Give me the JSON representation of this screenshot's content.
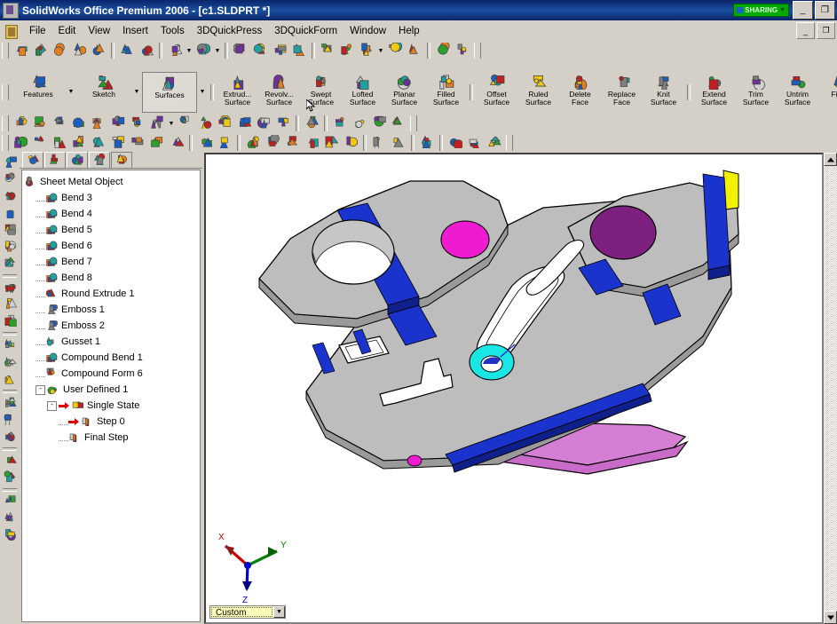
{
  "window": {
    "title": "SolidWorks Office Premium 2006 - [c1.SLDPRT *]",
    "app_icon": "solidworks-icon",
    "sharing_badge": "SHARING",
    "minimize_label": "_",
    "restore_label": "❐",
    "doc_minimize_label": "_",
    "doc_restore_label": "❐"
  },
  "menu": {
    "items": [
      {
        "label": "File"
      },
      {
        "label": "Edit"
      },
      {
        "label": "View"
      },
      {
        "label": "Insert"
      },
      {
        "label": "Tools"
      },
      {
        "label": "3DQuickPress"
      },
      {
        "label": "3DQuickForm"
      },
      {
        "label": "Window"
      },
      {
        "label": "Help"
      }
    ]
  },
  "standard_toolbar": {
    "buttons": [
      {
        "name": "new-document",
        "icon": "new-file-icon"
      },
      {
        "name": "open-document",
        "icon": "open-folder-icon"
      },
      {
        "name": "save-document",
        "icon": "save-disk-icon"
      },
      {
        "name": "make-drawing",
        "icon": "drawing-sheet-icon"
      },
      {
        "name": "make-assembly",
        "icon": "assembly-icon"
      },
      {
        "name": "print",
        "icon": "printer-icon"
      },
      {
        "name": "print-preview",
        "icon": "print-preview-icon"
      },
      {
        "name": "undo",
        "icon": "undo-arrow-icon"
      },
      {
        "name": "redo",
        "icon": "redo-arrow-icon"
      },
      {
        "name": "select",
        "icon": "arrow-cursor-icon"
      },
      {
        "name": "measure",
        "icon": "measure-icon"
      },
      {
        "name": "edit-color",
        "icon": "color-palette-icon"
      },
      {
        "name": "check-status",
        "icon": "traffic-light-icon"
      },
      {
        "name": "display-grid",
        "icon": "grid-icon"
      },
      {
        "name": "material-editor",
        "icon": "brick-material-icon"
      },
      {
        "name": "dimension-display",
        "icon": "dimension-icon"
      },
      {
        "name": "rebuild",
        "icon": "rebuild-traffic-icon"
      },
      {
        "name": "options",
        "icon": "options-gear-icon"
      },
      {
        "name": "help-topic",
        "icon": "help-question-icon"
      },
      {
        "name": "toolbox",
        "icon": "toolbox-icon"
      }
    ]
  },
  "feature_toolbar": {
    "groups": [
      {
        "name": "features",
        "label": "Features",
        "icon": "features-icon",
        "has_dropdown": true,
        "selected": false
      },
      {
        "name": "sketch",
        "label": "Sketch",
        "icon": "sketch-pencil-icon",
        "has_dropdown": true,
        "selected": false
      },
      {
        "name": "surfaces",
        "label": "Surfaces",
        "icon": "surfaces-icon",
        "has_dropdown": true,
        "selected": true
      }
    ],
    "buttons": [
      {
        "name": "extruded-surface",
        "line1": "Extrud...",
        "line2": "Surface",
        "icon": "extruded-surface-icon"
      },
      {
        "name": "revolved-surface",
        "line1": "Revolv...",
        "line2": "Surface",
        "icon": "revolved-surface-icon"
      },
      {
        "name": "swept-surface",
        "line1": "Swept",
        "line2": "Surface",
        "icon": "swept-surface-icon"
      },
      {
        "name": "lofted-surface",
        "line1": "Lofted",
        "line2": "Surface",
        "icon": "lofted-surface-icon"
      },
      {
        "name": "planar-surface",
        "line1": "Planar",
        "line2": "Surface",
        "icon": "planar-surface-icon"
      },
      {
        "name": "filled-surface",
        "line1": "Filled",
        "line2": "Surface",
        "icon": "filled-surface-icon"
      },
      {
        "name": "offset-surface",
        "line1": "Offset",
        "line2": "Surface",
        "icon": "offset-surface-icon"
      },
      {
        "name": "ruled-surface",
        "line1": "Ruled",
        "line2": "Surface",
        "icon": "ruled-surface-icon"
      },
      {
        "name": "delete-face",
        "line1": "Delete",
        "line2": "Face",
        "icon": "delete-face-icon"
      },
      {
        "name": "replace-face",
        "line1": "Replace",
        "line2": "Face",
        "icon": "replace-face-icon"
      },
      {
        "name": "knit-surface",
        "line1": "Knit",
        "line2": "Surface",
        "icon": "knit-surface-icon"
      },
      {
        "name": "extend-surface",
        "line1": "Extend",
        "line2": "Surface",
        "icon": "extend-surface-icon"
      },
      {
        "name": "trim-surface",
        "line1": "Trim",
        "line2": "Surface",
        "icon": "trim-surface-icon"
      },
      {
        "name": "untrim-surface",
        "line1": "Untrim",
        "line2": "Surface",
        "icon": "untrim-surface-icon"
      },
      {
        "name": "fillet",
        "line1": "Fillet",
        "line2": "",
        "icon": "fillet-icon"
      }
    ]
  },
  "view_toolbar": {
    "buttons": [
      {
        "name": "previous-view",
        "icon": "previous-view-icon"
      },
      {
        "name": "zoom-to-fit",
        "icon": "zoom-fit-icon"
      },
      {
        "name": "zoom-to-area",
        "icon": "zoom-area-icon"
      },
      {
        "name": "zoom-in-out",
        "icon": "zoom-in-out-icon"
      },
      {
        "name": "zoom-to-selection",
        "icon": "zoom-selection-icon"
      },
      {
        "name": "rotate-view",
        "icon": "rotate-view-icon"
      },
      {
        "name": "pan",
        "icon": "pan-icon"
      },
      {
        "name": "standard-views",
        "icon": "standard-views-icon",
        "has_dropdown": true
      },
      {
        "name": "wireframe",
        "icon": "wireframe-icon"
      },
      {
        "name": "hidden-lines-visible",
        "icon": "hidden-lines-visible-icon"
      },
      {
        "name": "hidden-lines-removed",
        "icon": "hidden-lines-removed-icon"
      },
      {
        "name": "shaded-with-edges",
        "icon": "shaded-edges-icon"
      },
      {
        "name": "shaded",
        "icon": "shaded-icon"
      },
      {
        "name": "shadows-in-shaded-mode",
        "icon": "shadows-icon"
      },
      {
        "name": "section-view",
        "icon": "section-view-icon"
      },
      {
        "name": "realview-graphics",
        "icon": "realview-icon"
      },
      {
        "name": "curvature-display",
        "icon": "curvature-icon"
      },
      {
        "name": "draft-analysis",
        "icon": "draft-analysis-icon"
      },
      {
        "name": "zebra-stripes",
        "icon": "zebra-stripes-icon"
      }
    ]
  },
  "sheetmetal_toolbar": {
    "buttons": [
      {
        "name": "base-flange",
        "icon": "base-flange-icon"
      },
      {
        "name": "flatten",
        "icon": "flatten-icon"
      },
      {
        "name": "insert-bends",
        "icon": "insert-bends-icon"
      },
      {
        "name": "edge-flange",
        "icon": "edge-flange-icon"
      },
      {
        "name": "miter-flange",
        "icon": "miter-flange-icon"
      },
      {
        "name": "hem",
        "icon": "hem-icon"
      },
      {
        "name": "jog",
        "icon": "jog-icon"
      },
      {
        "name": "sketched-bend",
        "icon": "sketched-bend-icon"
      },
      {
        "name": "closed-corner",
        "icon": "closed-corner-icon"
      },
      {
        "name": "quickpress-tool-a",
        "icon": "quickpress-icon-a"
      },
      {
        "name": "quickpress-tool-b",
        "icon": "quickpress-icon-b"
      },
      {
        "name": "form-tool-1",
        "icon": "form-tool-1-icon"
      },
      {
        "name": "form-tool-2",
        "icon": "form-tool-2-icon"
      },
      {
        "name": "form-tool-3",
        "icon": "form-tool-3-icon"
      },
      {
        "name": "form-tool-4",
        "icon": "form-tool-4-icon"
      },
      {
        "name": "form-tool-5",
        "icon": "form-tool-5-icon"
      },
      {
        "name": "form-tool-6",
        "icon": "form-tool-6-icon"
      },
      {
        "name": "form-tool-7",
        "icon": "form-tool-7-icon"
      },
      {
        "name": "form-tool-8",
        "icon": "form-tool-8-icon"
      },
      {
        "name": "form-tool-9",
        "icon": "form-tool-9-icon"
      },
      {
        "name": "mold-tool-1",
        "icon": "mold-tool-1-icon"
      },
      {
        "name": "mold-tool-2",
        "icon": "mold-tool-2-icon"
      },
      {
        "name": "mold-tool-3",
        "icon": "mold-tool-3-icon"
      }
    ]
  },
  "sketch_sidebar": {
    "buttons": [
      {
        "name": "sketch-tool-1",
        "icon": "sketch-entity-icon-1"
      },
      {
        "name": "sketch-tool-2",
        "icon": "sketch-entity-icon-2"
      },
      {
        "name": "sketch-tool-3",
        "icon": "sketch-entity-icon-3"
      },
      {
        "name": "sketch-tool-4",
        "icon": "sketch-entity-icon-4"
      },
      {
        "name": "sketch-tool-5",
        "icon": "sketch-entity-icon-5"
      },
      {
        "name": "sketch-tool-6",
        "icon": "sketch-entity-icon-6"
      },
      {
        "name": "sketch-tool-7",
        "icon": "sketch-entity-icon-7"
      },
      {
        "name": "edit-sketch",
        "icon": "edit-sketch-icon"
      },
      {
        "name": "add-relation",
        "icon": "add-relation-icon"
      },
      {
        "name": "display-delete-relations",
        "icon": "display-relations-icon"
      },
      {
        "name": "mirror-entities",
        "icon": "mirror-entities-icon"
      },
      {
        "name": "offset-entities",
        "icon": "offset-entities-icon"
      },
      {
        "name": "convert-entities",
        "icon": "convert-entities-icon"
      },
      {
        "name": "trim-entities",
        "icon": "trim-entities-icon"
      },
      {
        "name": "text-tool",
        "icon": "text-tool-icon"
      },
      {
        "name": "construction-geometry",
        "icon": "construction-geometry-icon"
      },
      {
        "name": "linear-pattern",
        "icon": "linear-pattern-icon"
      },
      {
        "name": "circular-pattern",
        "icon": "circular-pattern-icon"
      },
      {
        "name": "dimension-tool",
        "icon": "smart-dimension-icon"
      },
      {
        "name": "measure-tool",
        "icon": "measure-tool-icon"
      },
      {
        "name": "section-property",
        "icon": "section-property-icon"
      }
    ]
  },
  "feature_manager": {
    "tabs": [
      {
        "name": "feature-manager-tab",
        "icon": "feature-tree-icon",
        "active": false
      },
      {
        "name": "property-manager-tab",
        "icon": "property-clipboard-icon",
        "active": false
      },
      {
        "name": "configuration-manager-tab",
        "icon": "configuration-icon",
        "active": false
      },
      {
        "name": "dimxpert-tab",
        "icon": "dimxpert-icon",
        "active": false
      },
      {
        "name": "quickpress-manager-tab",
        "icon": "quickpress-manager-icon",
        "active": true
      }
    ],
    "tree": [
      {
        "label": "Sheet Metal Object",
        "icon": "sheet-metal-object-icon",
        "depth": 0,
        "expander": "",
        "arrow": false
      },
      {
        "label": "Bend 3",
        "icon": "bend-icon",
        "depth": 1,
        "expander": "",
        "arrow": false
      },
      {
        "label": "Bend 4",
        "icon": "bend-icon",
        "depth": 1,
        "expander": "",
        "arrow": false
      },
      {
        "label": "Bend 5",
        "icon": "bend-icon",
        "depth": 1,
        "expander": "",
        "arrow": false
      },
      {
        "label": "Bend 6",
        "icon": "bend-icon",
        "depth": 1,
        "expander": "",
        "arrow": false
      },
      {
        "label": "Bend 7",
        "icon": "bend-icon",
        "depth": 1,
        "expander": "",
        "arrow": false
      },
      {
        "label": "Bend 8",
        "icon": "bend-icon",
        "depth": 1,
        "expander": "",
        "arrow": false
      },
      {
        "label": "Round Extrude 1",
        "icon": "round-extrude-icon",
        "depth": 1,
        "expander": "",
        "arrow": false
      },
      {
        "label": "Emboss 1",
        "icon": "emboss-icon",
        "depth": 1,
        "expander": "",
        "arrow": false
      },
      {
        "label": "Emboss 2",
        "icon": "emboss-icon",
        "depth": 1,
        "expander": "",
        "arrow": false
      },
      {
        "label": "Gusset 1",
        "icon": "gusset-icon",
        "depth": 1,
        "expander": "",
        "arrow": false
      },
      {
        "label": "Compound Bend 1",
        "icon": "bend-icon",
        "depth": 1,
        "expander": "",
        "arrow": false
      },
      {
        "label": "Compound Form 6",
        "icon": "compound-form-icon",
        "depth": 1,
        "expander": "",
        "arrow": false
      },
      {
        "label": "User Defined 1",
        "icon": "user-defined-icon",
        "depth": 1,
        "expander": "-",
        "arrow": false
      },
      {
        "label": "Single State",
        "icon": "single-state-icon",
        "depth": 2,
        "expander": "-",
        "arrow": true
      },
      {
        "label": "Step 0",
        "icon": "step-icon",
        "depth": 3,
        "expander": "",
        "arrow": true
      },
      {
        "label": "Final Step",
        "icon": "step-icon",
        "depth": 3,
        "expander": "",
        "arrow": false
      }
    ]
  },
  "graphics": {
    "config_selector_value": "Custom",
    "config_selector_dropdown": "▼",
    "triad": {
      "x_label": "X",
      "x_color": "#cc0000",
      "y_label": "Y",
      "y_color": "#008000",
      "z_label": "Z",
      "z_color": "#0000cc"
    },
    "model": {
      "name": "sheet-metal-part-c1",
      "body_color": "#bdbdbd",
      "bend_band_color": "#1a33cc",
      "magenta_boss_color": "#ef1bd0",
      "purple_boss_color": "#7d2080",
      "cyan_ring_color": "#1ae6e6",
      "pink_flange_color": "#d47fd4",
      "yellow_edge_color": "#f2f200",
      "edge_color": "#000000"
    }
  },
  "scrollbar": {
    "up_arrow": "▲",
    "down_arrow": "▼"
  }
}
